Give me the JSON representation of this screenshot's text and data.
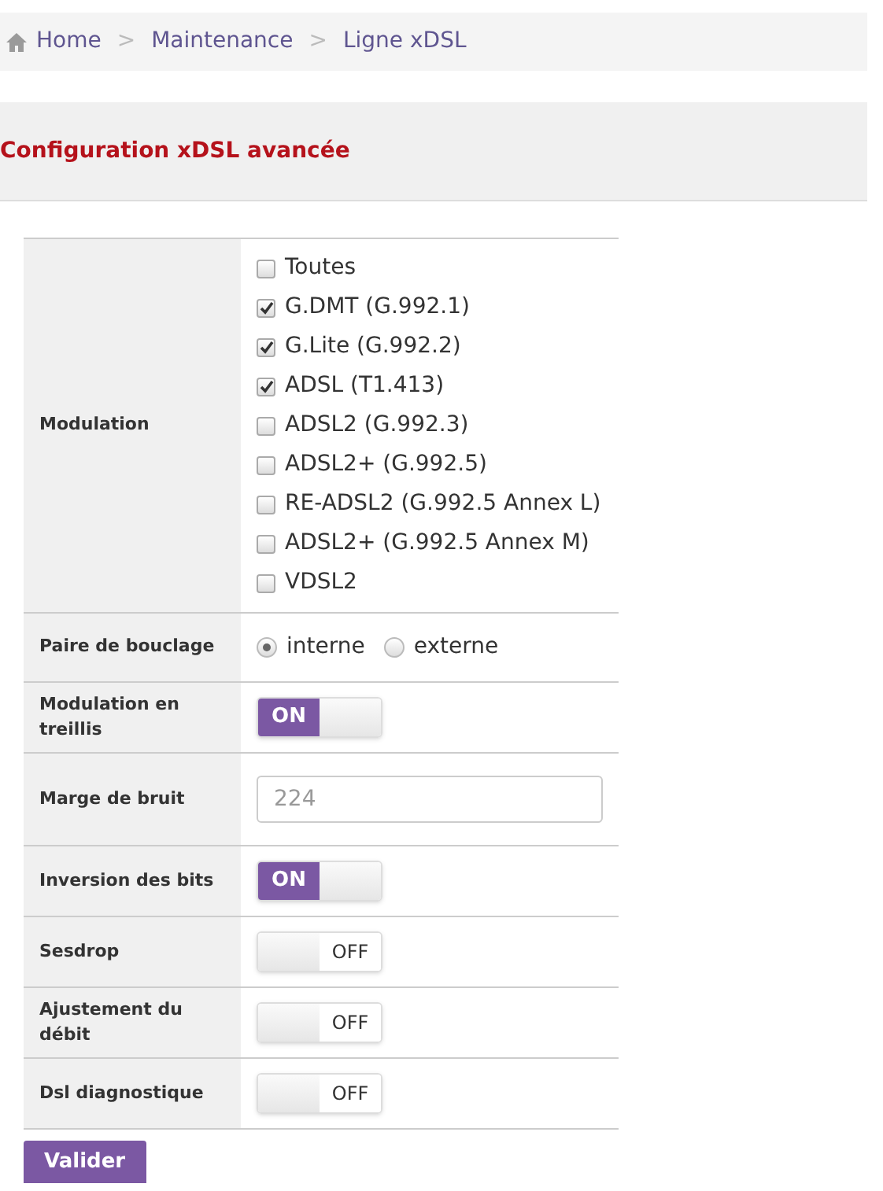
{
  "breadcrumb": [
    {
      "label": "Home",
      "kind": "home"
    },
    {
      "label": "Maintenance",
      "kind": "link"
    },
    {
      "label": "Ligne xDSL",
      "kind": "link"
    }
  ],
  "breadcrumb_separator": ">",
  "section_title": "Configuration xDSL avancée",
  "rows": [
    {
      "label": "Modulation",
      "kind": "checkboxes",
      "options": [
        {
          "label": "Toutes",
          "checked": false
        },
        {
          "label": "G.DMT (G.992.1)",
          "checked": true
        },
        {
          "label": "G.Lite (G.992.2)",
          "checked": true
        },
        {
          "label": "ADSL (T1.413)",
          "checked": true
        },
        {
          "label": "ADSL2 (G.992.3)",
          "checked": false
        },
        {
          "label": "ADSL2+ (G.992.5)",
          "checked": false
        },
        {
          "label": "RE-ADSL2 (G.992.5 Annex L)",
          "checked": false
        },
        {
          "label": "ADSL2+ (G.992.5 Annex M)",
          "checked": false
        },
        {
          "label": "VDSL2",
          "checked": false
        }
      ]
    },
    {
      "label": "Paire de bouclage",
      "kind": "radios",
      "options": [
        {
          "label": "interne",
          "selected": true
        },
        {
          "label": "externe",
          "selected": false
        }
      ]
    },
    {
      "label": "Modulation en treillis",
      "kind": "toggle",
      "on": true,
      "text": "ON"
    },
    {
      "label": "Marge de bruit",
      "kind": "input",
      "placeholder": "224"
    },
    {
      "label": "Inversion des bits",
      "kind": "toggle",
      "on": true,
      "text": "ON"
    },
    {
      "label": "Sesdrop",
      "kind": "toggle",
      "on": false,
      "text": "OFF"
    },
    {
      "label": "Ajustement du débit",
      "kind": "toggle",
      "on": false,
      "text": "OFF"
    },
    {
      "label": "Dsl diagnostique",
      "kind": "toggle",
      "on": false,
      "text": "OFF"
    }
  ],
  "submit_button": "Valider"
}
